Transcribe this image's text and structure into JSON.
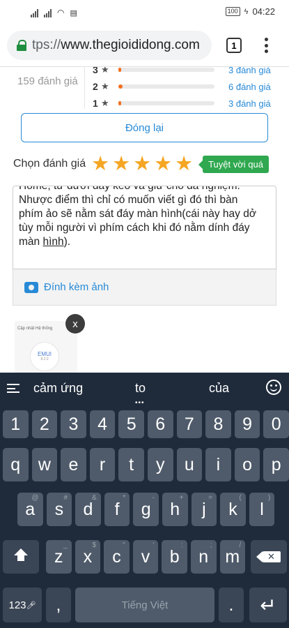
{
  "status_bar": {
    "time": "04:22",
    "battery": "100"
  },
  "browser": {
    "url_prefix": "tps://",
    "url_host": "www.thegioididong.com",
    "tab_count": "1"
  },
  "rating_summary": {
    "total": "159 đánh giá",
    "rows": [
      {
        "stars": "3",
        "count": "3 đánh giá",
        "fraction": 0.02
      },
      {
        "stars": "2",
        "count": "6 đánh giá",
        "fraction": 0.04
      },
      {
        "stars": "1",
        "count": "3 đánh giá",
        "fraction": 0.02
      }
    ]
  },
  "close_button": "Đóng lại",
  "rate": {
    "label": "Chọn đánh giá",
    "stars_selected": 5,
    "badge": "Tuyệt vời quá"
  },
  "review_text_lines": [
    "Home, từ dưới đây kéo và giữ cho đa nghiệm.",
    "Nhược điểm thì chỉ có muốn viết gì đó thì bàn",
    "phím ảo sẽ nằm sát đáy màn hình(cái này hay dở",
    "tùy mỗi người vì phím cách khi đó nằm dính đáy",
    "màn "
  ],
  "review_text_underlined": "hình",
  "review_text_end": ").",
  "attach_label": "Đính kèm ảnh",
  "thumbnail": {
    "header": "Cập nhật Hệ thống",
    "logo": "EMUI",
    "version": "8.2.0"
  },
  "remove_label": "x",
  "keyboard": {
    "suggestions": [
      "cảm ứng",
      "to",
      "của"
    ],
    "row_numbers": [
      "1",
      "2",
      "3",
      "4",
      "5",
      "6",
      "7",
      "8",
      "9",
      "0"
    ],
    "row1": [
      {
        "k": "q",
        "h": ""
      },
      {
        "k": "w",
        "h": ""
      },
      {
        "k": "e",
        "h": ""
      },
      {
        "k": "r",
        "h": ""
      },
      {
        "k": "t",
        "h": ""
      },
      {
        "k": "y",
        "h": ""
      },
      {
        "k": "u",
        "h": ""
      },
      {
        "k": "i",
        "h": ""
      },
      {
        "k": "o",
        "h": ""
      },
      {
        "k": "p",
        "h": ""
      }
    ],
    "row2": [
      {
        "k": "a",
        "h": "@"
      },
      {
        "k": "s",
        "h": "#"
      },
      {
        "k": "d",
        "h": "&"
      },
      {
        "k": "f",
        "h": "*"
      },
      {
        "k": "g",
        "h": "-"
      },
      {
        "k": "h",
        "h": "+"
      },
      {
        "k": "j",
        "h": "="
      },
      {
        "k": "k",
        "h": "("
      },
      {
        "k": "l",
        "h": ")"
      }
    ],
    "row3": [
      {
        "k": "z",
        "h": "_"
      },
      {
        "k": "x",
        "h": "$"
      },
      {
        "k": "c",
        "h": "\""
      },
      {
        "k": "v",
        "h": "'"
      },
      {
        "k": "b",
        "h": ":"
      },
      {
        "k": "n",
        "h": ";"
      },
      {
        "k": "m",
        "h": "/"
      }
    ],
    "key_123": "123",
    "comma": ",",
    "space": "Tiếng Việt",
    "period": "."
  }
}
